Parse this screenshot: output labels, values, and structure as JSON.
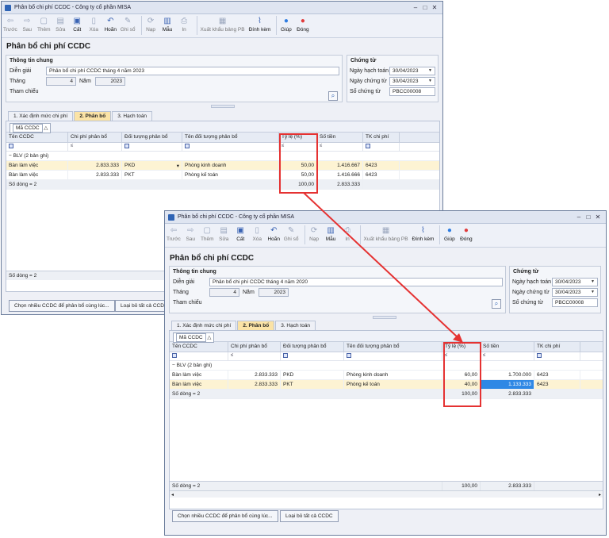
{
  "back_window": {
    "title": "Phân bổ chi phí CCDC - Công ty cổ phần MISA",
    "toolbar": [
      {
        "label": "Trước",
        "icon": "arrow-left-icon",
        "enabled": false
      },
      {
        "label": "Sau",
        "icon": "arrow-right-icon",
        "enabled": false
      },
      {
        "label": "Thêm",
        "icon": "new-document-icon",
        "enabled": false
      },
      {
        "label": "Sửa",
        "icon": "edit-icon",
        "enabled": false
      },
      {
        "label": "Cất",
        "icon": "save-icon",
        "enabled": true
      },
      {
        "label": "Xóa",
        "icon": "delete-icon",
        "enabled": false
      },
      {
        "label": "Hoãn",
        "icon": "undo-icon",
        "enabled": true
      },
      {
        "label": "Ghi sổ",
        "icon": "pen-icon",
        "enabled": false
      },
      {
        "label": "Nạp",
        "icon": "reload-icon",
        "enabled": false
      },
      {
        "label": "Mẫu",
        "icon": "template-icon",
        "enabled": true
      },
      {
        "label": "In",
        "icon": "print-icon",
        "enabled": false
      },
      {
        "label": "Xuất khẩu bảng PB",
        "icon": "export-icon",
        "enabled": false
      },
      {
        "label": "Đính kèm",
        "icon": "attach-icon",
        "enabled": true
      },
      {
        "label": "Giúp",
        "icon": "help-icon",
        "enabled": true
      },
      {
        "label": "Đóng",
        "icon": "close-circle-icon",
        "enabled": true
      }
    ],
    "page_title": "Phân bổ chi phí CCDC",
    "general": {
      "group_title": "Thông tin chung",
      "description_label": "Diễn giải",
      "description_value": "Phân bổ chi phí CCDC tháng 4 năm 2023",
      "month_label": "Tháng",
      "month_value": "4",
      "year_label": "Năm",
      "year_value": "2023",
      "reference_label": "Tham chiếu"
    },
    "voucher": {
      "group_title": "Chứng từ",
      "posting_date_label": "Ngày hạch toán",
      "posting_date_value": "30/04/2023",
      "voucher_date_label": "Ngày chứng từ",
      "voucher_date_value": "30/04/2023",
      "voucher_no_label": "Số chứng từ",
      "voucher_no_value": "PBCC00008"
    },
    "tabs": [
      "1. Xác định mức chi phí",
      "2. Phân bổ",
      "3. Hạch toán"
    ],
    "group_by_chip": "Mã CCDC",
    "columns": [
      "Tên CCDC",
      "Chi phí phân bổ",
      "Đối tượng phân bổ",
      "Tên đối tượng phân bổ",
      "Tỷ lệ (%)",
      "Số tiền",
      "TK chi phí"
    ],
    "filter_ops": [
      "",
      "≤",
      "",
      "",
      "≤",
      "≤",
      ""
    ],
    "group_label": "BLV (2 bản ghi)",
    "rows": [
      [
        "Bàn làm việc",
        "2.833.333",
        "PKD",
        "Phòng kinh doanh",
        "50,00",
        "1.416.667",
        "6423"
      ],
      [
        "Bàn làm việc",
        "2.833.333",
        "PKT",
        "Phòng kế toán",
        "50,00",
        "1.416.666",
        "6423"
      ]
    ],
    "group_total": {
      "label": "Số dòng = 2",
      "rate": "100,00",
      "amount": "2.833.333"
    },
    "footer_label": "Số dòng = 2",
    "buttons": [
      "Chọn nhiều CCDC để phân bổ cùng lúc...",
      "Loại bỏ tất cả CCDC"
    ]
  },
  "front_window": {
    "title": "Phân bổ chi phí CCDC - Công ty cổ phần MISA",
    "page_title": "Phân bổ chi phí CCDC",
    "general": {
      "group_title": "Thông tin chung",
      "description_label": "Diễn giải",
      "description_value": "Phân bổ chi phí CCDC tháng 4 năm 2020",
      "month_label": "Tháng",
      "month_value": "4",
      "year_label": "Năm",
      "year_value": "2023",
      "reference_label": "Tham chiếu"
    },
    "voucher": {
      "group_title": "Chứng từ",
      "posting_date_label": "Ngày hạch toán",
      "posting_date_value": "30/04/2023",
      "voucher_date_label": "Ngày chứng từ",
      "voucher_date_value": "30/04/2023",
      "voucher_no_label": "Số chứng từ",
      "voucher_no_value": "PBCC00008"
    },
    "tabs": [
      "1. Xác định mức chi phí",
      "2. Phân bổ",
      "3. Hạch toán"
    ],
    "group_by_chip": "Mã CCDC",
    "columns": [
      "Tên CCDC",
      "Chi phí phân bổ",
      "Đối tượng phân bổ",
      "Tên đối tượng phân bổ",
      "Tỷ lệ (%)",
      "Số tiền",
      "TK chi phí"
    ],
    "group_label": "BLV (2 bản ghi)",
    "rows": [
      [
        "Bàn làm việc",
        "2.833.333",
        "PKD",
        "Phòng kinh doanh",
        "60,00",
        "1.700.000",
        "6423"
      ],
      [
        "Bàn làm việc",
        "2.833.333",
        "PKT",
        "Phòng kế toán",
        "40,00",
        "1.133.333",
        "6423"
      ]
    ],
    "group_total": {
      "label": "Số dòng = 2",
      "rate": "100,00",
      "amount": "2.833.333"
    },
    "footer": {
      "label": "Số dòng = 2",
      "rate": "100,00",
      "amount": "2.833.333"
    },
    "buttons": [
      "Chọn nhiều CCDC để phân bổ cùng lúc...",
      "Loại bỏ tất cả CCDC"
    ]
  },
  "annotation_color": "#e53232"
}
